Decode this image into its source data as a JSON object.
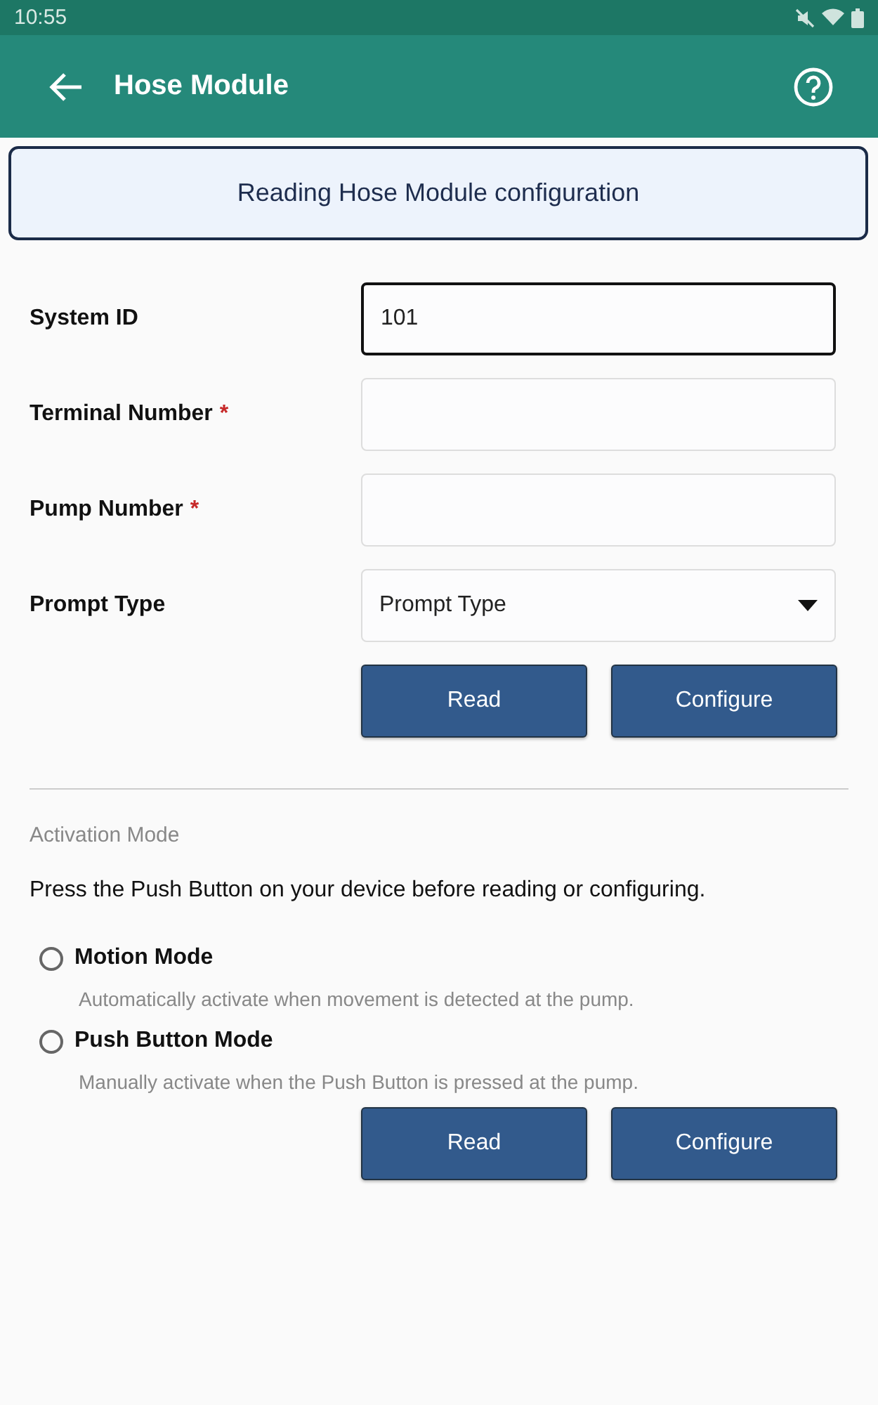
{
  "status_bar": {
    "time": "10:55"
  },
  "app_bar": {
    "title": "Hose Module"
  },
  "toast": {
    "message": "Reading Hose Module configuration"
  },
  "form": {
    "fields": [
      {
        "kind": "input",
        "label": "System ID",
        "value": "101",
        "focused": true
      },
      {
        "kind": "input",
        "label": "Terminal Number",
        "required_mark": "*",
        "focused": false
      },
      {
        "kind": "input",
        "label": "Pump Number",
        "required_mark": "*",
        "focused": false
      },
      {
        "kind": "dropdown",
        "label": "Prompt Type",
        "placeholder": "Prompt Type",
        "focused": false
      }
    ],
    "buttons": [
      "Read",
      "Configure"
    ]
  },
  "activation": {
    "title": "Activation Mode",
    "hint": "Press the Push Button on your device before reading or configuring.",
    "options": [
      {
        "label": "Motion Mode",
        "description": "Automatically activate when movement is detected at the pump.",
        "selected": false
      },
      {
        "label": "Push Button Mode",
        "description": "Manually activate when the Push Button is pressed at the pump.",
        "selected": false
      }
    ],
    "buttons": [
      "Read",
      "Configure"
    ]
  }
}
